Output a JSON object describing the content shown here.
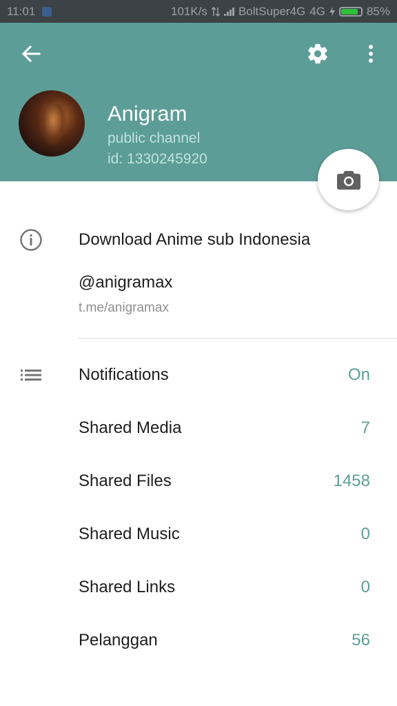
{
  "status_bar": {
    "time": "11:01",
    "network_speed": "101K/s",
    "carrier": "BoltSuper4G",
    "network_type": "4G",
    "battery": "85%",
    "battery_level": 0.85
  },
  "header": {
    "channel_name": "Anigram",
    "channel_type": "public channel",
    "channel_id": "id: 1330245920",
    "background_color": "#5d9d97"
  },
  "info": {
    "description": "Download Anime sub Indonesia",
    "username": "@anigramax",
    "link": "t.me/anigramax"
  },
  "settings": [
    {
      "label": "Notifications",
      "value": "On"
    },
    {
      "label": "Shared Media",
      "value": "7"
    },
    {
      "label": "Shared Files",
      "value": "1458"
    },
    {
      "label": "Shared Music",
      "value": "0"
    },
    {
      "label": "Shared Links",
      "value": "0"
    },
    {
      "label": "Pelanggan",
      "value": "56"
    }
  ],
  "colors": {
    "accent": "#5d9d97",
    "status_bar": "#3c4246",
    "battery": "#2fbf3a"
  }
}
